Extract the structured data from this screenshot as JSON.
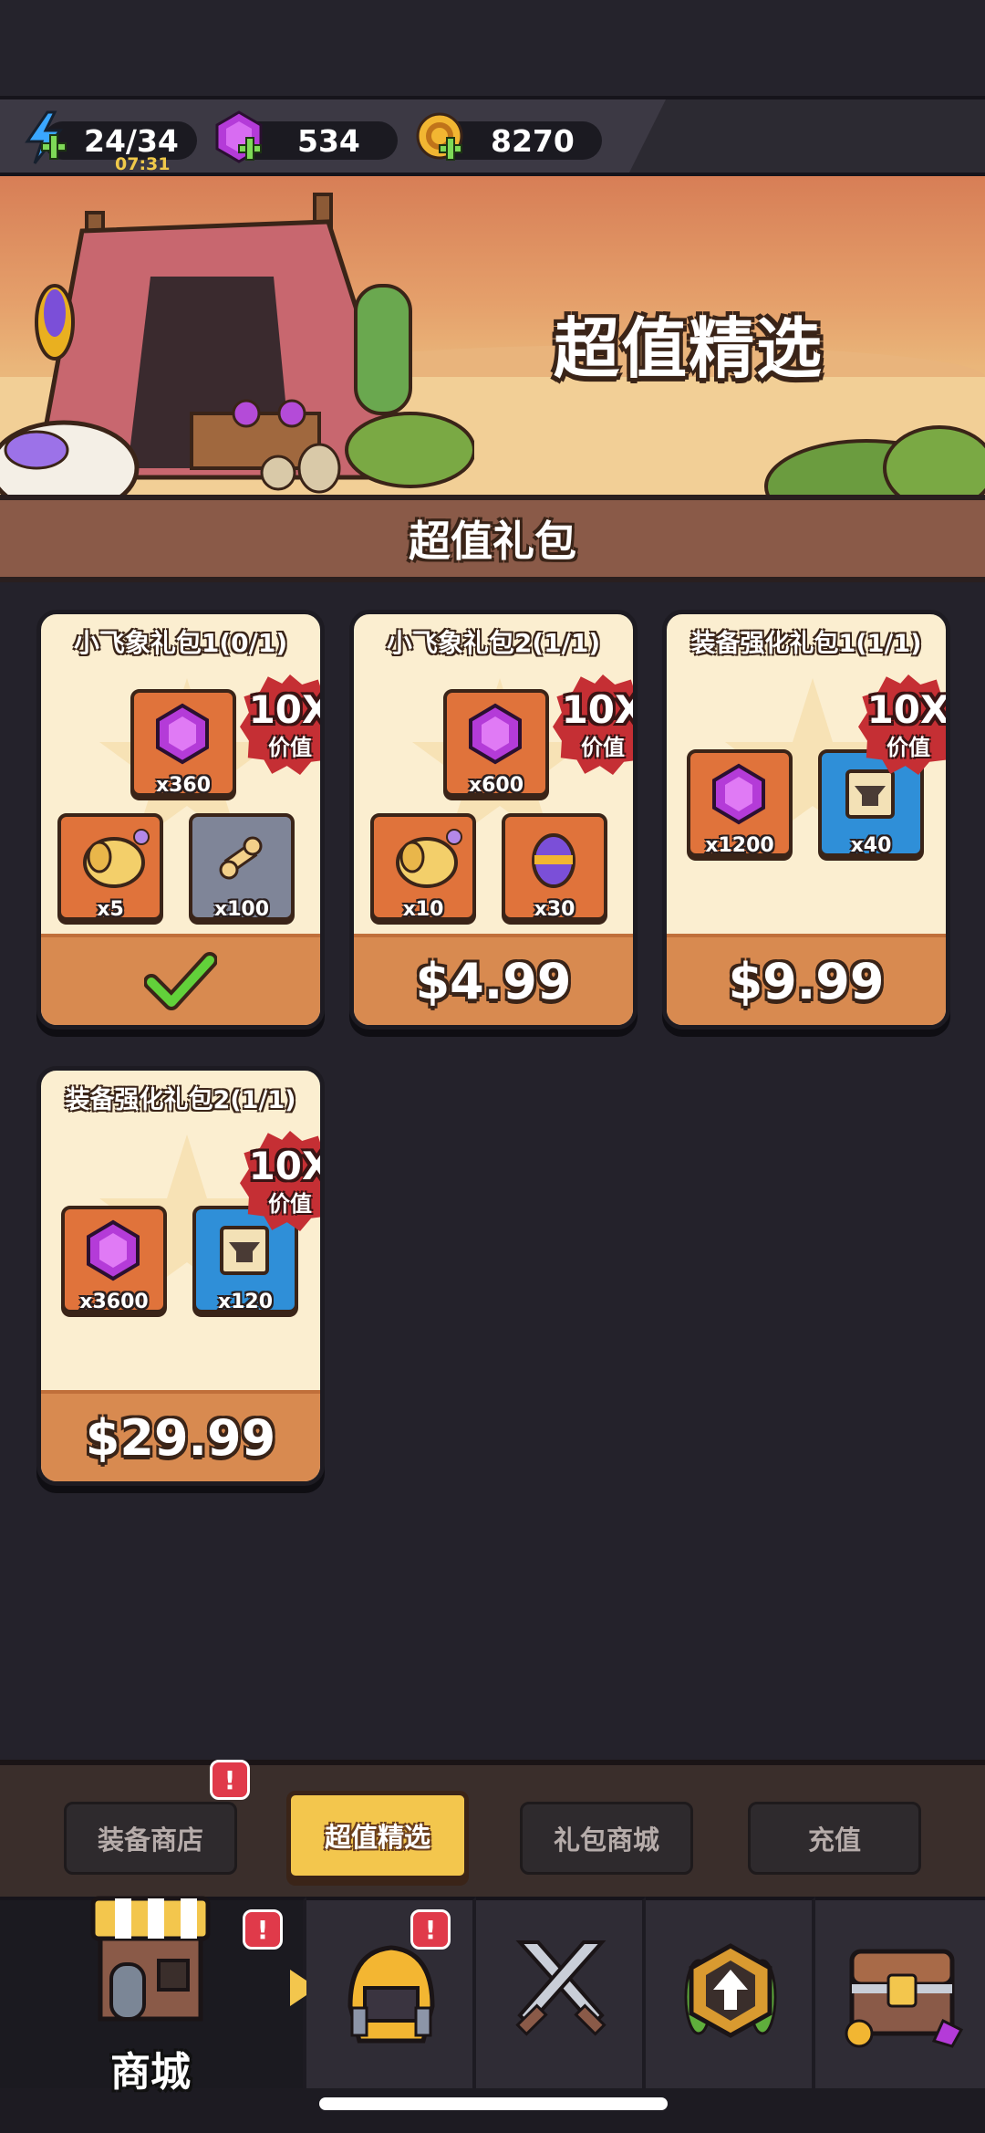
{
  "resources": {
    "energy": {
      "value": "24/34",
      "timer": "07:31",
      "icon": "lightning-icon"
    },
    "gems": {
      "value": "534",
      "icon": "gem-icon"
    },
    "coins": {
      "value": "8270",
      "icon": "coin-icon"
    }
  },
  "banner": {
    "title": "超值精选"
  },
  "section": {
    "title": "超值礼包"
  },
  "packs": [
    {
      "title": "小飞象礼包1(0/1)",
      "badge_main": "10X",
      "badge_sub": "价值",
      "items": [
        {
          "icon": "gem-icon",
          "qty": "x360"
        },
        {
          "icon": "elephant-pet-icon",
          "qty": "x5"
        },
        {
          "icon": "bone-icon",
          "qty": "x100"
        }
      ],
      "footer": "purchased",
      "price": ""
    },
    {
      "title": "小飞象礼包2(1/1)",
      "badge_main": "10X",
      "badge_sub": "价值",
      "items": [
        {
          "icon": "gem-icon",
          "qty": "x600"
        },
        {
          "icon": "elephant-pet-icon",
          "qty": "x10"
        },
        {
          "icon": "egg-icon",
          "qty": "x30"
        }
      ],
      "price": "$4.99"
    },
    {
      "title": "装备强化礼包1(1/1)",
      "badge_main": "10X",
      "badge_sub": "价值",
      "items": [
        {
          "icon": "gem-icon",
          "qty": "x1200"
        },
        {
          "icon": "anvil-scroll-icon",
          "qty": "x40"
        }
      ],
      "price": "$9.99"
    },
    {
      "title": "装备强化礼包2(1/1)",
      "badge_main": "10X",
      "badge_sub": "价值",
      "items": [
        {
          "icon": "gem-icon",
          "qty": "x3600"
        },
        {
          "icon": "anvil-scroll-icon",
          "qty": "x120"
        }
      ],
      "price": "$29.99"
    }
  ],
  "tabs": [
    {
      "label": "装备商店",
      "alert": "!"
    },
    {
      "label": "超值精选",
      "active": true
    },
    {
      "label": "礼包商城"
    },
    {
      "label": "充值"
    }
  ],
  "nav": {
    "shop_label": "商城",
    "shop_alert": "!",
    "equipment_alert": "!",
    "items": [
      "shop-icon",
      "helmet-icon",
      "crossed-swords-icon",
      "upgrade-icon",
      "treasure-chest-icon"
    ]
  },
  "colors": {
    "accent": "#f3c64d",
    "card": "#fbeed0",
    "footer": "#d88a50",
    "badge": "#c52f34"
  }
}
